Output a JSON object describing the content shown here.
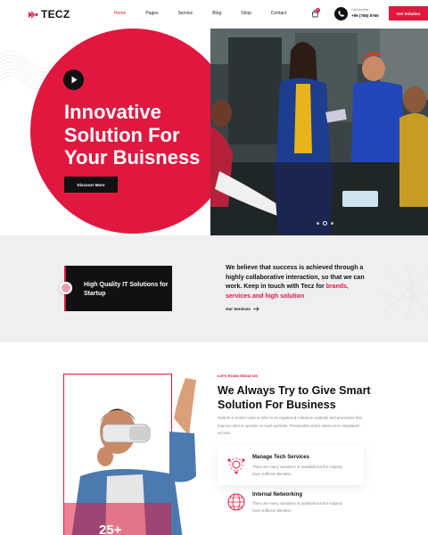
{
  "header": {
    "logo": "TECZ",
    "nav": [
      "Home",
      "Pages",
      "Service",
      "Blog",
      "Shop",
      "Contact"
    ],
    "active_nav": "Home",
    "cart_count": "0",
    "call_label": "Call Anytime",
    "call_number": "+99 (786) 8765",
    "cta": "Get Solution"
  },
  "hero": {
    "title": "Innovative Solution For Your Buisness",
    "button": "Discover More",
    "slides": 3,
    "active_slide": 2
  },
  "band": {
    "card_text": "High Quality IT Solutions for Startup",
    "text_main": "We believe that success is achieved through a highly collaborative interaction, so that we can work. Keep in touch with Tecz for",
    "text_highlight": "brands, services and high solution",
    "link": "Our Services"
  },
  "about": {
    "eyebrow": "Let's Know About Us",
    "title": "We Always Try to Give Smart Solution For Business",
    "description": "System is a term used to refer to an organized collection symbols and processes that may be used to operate on such symbols. Perspiciatis omnis natus error voluptatem accusa",
    "years": "25+",
    "services": [
      {
        "title": "Manage Tech Services",
        "desc": "There are many variations of available but the majority have suffered alteration"
      },
      {
        "title": "Internal Networking",
        "desc": "There are many variations of available but the majority have suffered alteration"
      }
    ]
  },
  "colors": {
    "accent": "#e0183f",
    "dark": "#111111",
    "band_bg": "#efeff1"
  }
}
